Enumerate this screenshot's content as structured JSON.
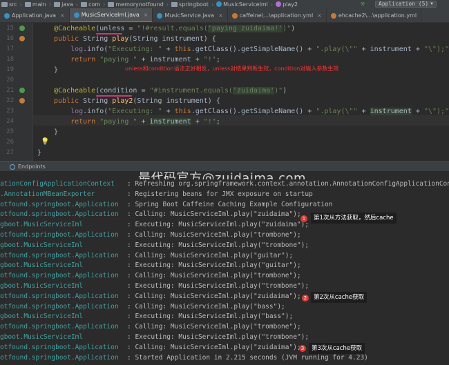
{
  "breadcrumb": [
    "src",
    "main",
    "java",
    "com",
    "memorynotfound",
    "springboot",
    "MusicServiceIml",
    "play2"
  ],
  "run_config": "Application (5)",
  "tabs": [
    {
      "label": "Application.java",
      "active": false
    },
    {
      "label": "MusicServiceIml.java",
      "active": true
    },
    {
      "label": "MusicService.java",
      "active": false
    },
    {
      "label": "caffeine\\...\\application.yml",
      "active": false
    },
    {
      "label": "ehcache2\\...\\application.yml",
      "active": false
    }
  ],
  "editor": {
    "line_numbers": [
      "15",
      "16",
      "17",
      "18",
      "19",
      "20",
      "21",
      "22",
      "23",
      "24",
      "25",
      "26",
      "27"
    ],
    "annotation_note": "unless和condition语法正好相反，unless对结果判断生效，condition对输入参数生效"
  },
  "tool_window": {
    "tab_label": "Endpoints",
    "watermark": "最代码官方@zuidaima.com"
  },
  "console": {
    "rows": [
      {
        "logger": "ationConfigApplicationContext",
        "msg": ": Refreshing org.springframework.context.annotation.AnnotationConfigApplicationCon"
      },
      {
        "logger": ".AnnotationMBeanExporter",
        "msg": ": Registering beans for JMX exposure on startup"
      },
      {
        "logger": "otfound.springboot.Application",
        "msg": ": Spring Boot Caffeine Caching Example Configuration"
      },
      {
        "logger": "otfound.springboot.Application",
        "msg": ": Calling: MusicServiceIml.play(\"zuidaima\");"
      },
      {
        "logger": "gboot.MusicServiceIml",
        "msg": ": Executing: MusicServiceIml.play(\"zuidaima\");"
      },
      {
        "logger": "otfound.springboot.Application",
        "msg": ": Calling: MusicServiceIml.play(\"trombone\");"
      },
      {
        "logger": "gboot.MusicServiceIml",
        "msg": ": Executing: MusicServiceIml.play(\"trombone\");"
      },
      {
        "logger": "otfound.springboot.Application",
        "msg": ": Calling: MusicServiceIml.play(\"guitar\");"
      },
      {
        "logger": "gboot.MusicServiceIml",
        "msg": ": Executing: MusicServiceIml.play(\"guitar\");"
      },
      {
        "logger": "otfound.springboot.Application",
        "msg": ": Calling: MusicServiceIml.play(\"trombone\");"
      },
      {
        "logger": "gboot.MusicServiceIml",
        "msg": ": Executing: MusicServiceIml.play(\"trombone\");"
      },
      {
        "logger": "otfound.springboot.Application",
        "msg": ": Calling: MusicServiceIml.play(\"zuidaima\");"
      },
      {
        "logger": "otfound.springboot.Application",
        "msg": ": Calling: MusicServiceIml.play(\"bass\");"
      },
      {
        "logger": "gboot.MusicServiceIml",
        "msg": ": Executing: MusicServiceIml.play(\"bass\");"
      },
      {
        "logger": "otfound.springboot.Application",
        "msg": ": Calling: MusicServiceIml.play(\"trombone\");"
      },
      {
        "logger": "gboot.MusicServiceIml",
        "msg": ": Executing: MusicServiceIml.play(\"trombone\");"
      },
      {
        "logger": "otfound.springboot.Application",
        "msg": ": Calling: MusicServiceIml.play(\"zuidaima\");"
      },
      {
        "logger": "otfound.springboot.Application",
        "msg": ": Started Application in 2.215 seconds (JVM running for 4.23)"
      }
    ],
    "notes": [
      {
        "badge": "1",
        "text": "第1次从方法获取，然后cache"
      },
      {
        "badge": "2",
        "text": "第2次从cache获取"
      },
      {
        "badge": "3",
        "text": "第3次从cache获取"
      }
    ]
  }
}
